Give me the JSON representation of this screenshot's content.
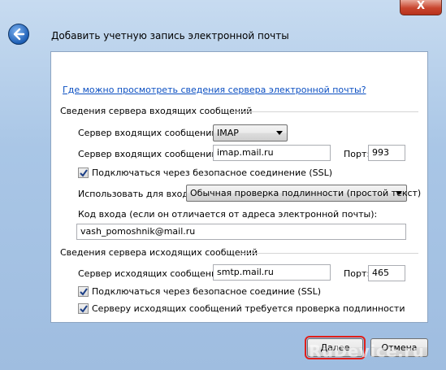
{
  "window": {
    "close_label": "X",
    "title": "Добавить учетную запись электронной почты"
  },
  "help_link": "Где можно просмотреть сведения сервера электронной почты?",
  "incoming": {
    "section_title": "Сведения сервера входящих сообщений",
    "server_type_label": "Сервер входящих сообщений",
    "server_type_value": "IMAP",
    "server_label": "Сервер входящих сообщений:",
    "server_value": "imap.mail.ru",
    "port_label": "Порт:",
    "port_value": "993",
    "ssl_label": "Подключаться через безопасное соединение (SSL)",
    "ssl_checked": true,
    "login_method_label": "Использовать для входа:",
    "login_method_value": "Обычная проверка подлинности (простой текст)",
    "login_label": "Код входа (если он отличается от адреса электронной почты):",
    "login_value": "vash_pomoshnik@mail.ru"
  },
  "outgoing": {
    "section_title": "Сведения сервера исходящих сообщений",
    "server_label": "Сервер исходящих сообщений:",
    "server_value": "smtp.mail.ru",
    "port_label": "Порт:",
    "port_value": "465",
    "ssl_label": "Подключаться через безопасное соединие (SSL)",
    "auth_label": "Серверу исходящих сообщений требуется проверка подлинности",
    "ssl_checked": true,
    "auth_checked": true
  },
  "footer": {
    "next_label": "Далее",
    "cancel_label": "Отмена"
  },
  "watermark": "RuDevice.ru",
  "colors": {
    "link": "#0b4fc2",
    "highlight": "#e0201a"
  }
}
